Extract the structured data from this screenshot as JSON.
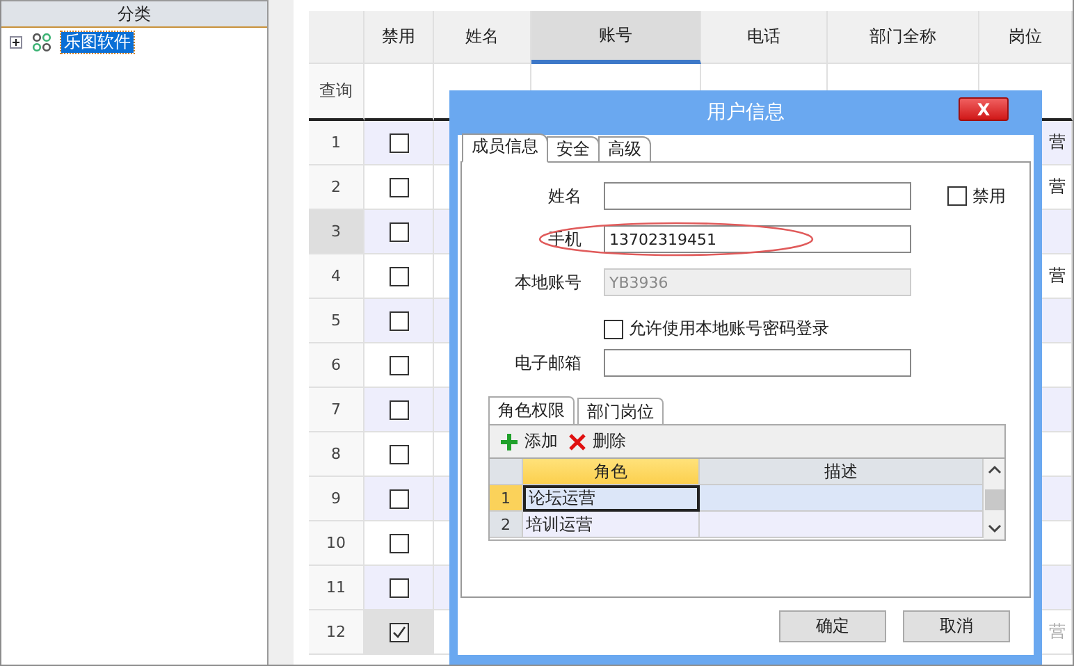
{
  "category_panel": {
    "title": "分类",
    "tree": [
      {
        "label": "乐图软件",
        "selected": true,
        "expanded": false
      }
    ]
  },
  "table": {
    "columns": [
      {
        "label": "禁用",
        "selected": false
      },
      {
        "label": "姓名",
        "selected": false
      },
      {
        "label": "账号",
        "selected": true
      },
      {
        "label": "电话",
        "selected": false
      },
      {
        "label": "部门全称",
        "selected": false
      },
      {
        "label": "岗位",
        "selected": false
      }
    ],
    "query_label": "查询",
    "rows": [
      {
        "index": "1",
        "disabled": false,
        "selected": false,
        "post": "营"
      },
      {
        "index": "2",
        "disabled": false,
        "selected": false,
        "post": "营"
      },
      {
        "index": "3",
        "disabled": false,
        "selected": true
      },
      {
        "index": "4",
        "disabled": false,
        "selected": false,
        "post": "营"
      },
      {
        "index": "5",
        "disabled": false,
        "selected": false
      },
      {
        "index": "6",
        "disabled": false,
        "selected": false
      },
      {
        "index": "7",
        "disabled": false,
        "selected": false
      },
      {
        "index": "8",
        "disabled": false,
        "selected": false
      },
      {
        "index": "9",
        "disabled": false,
        "selected": false
      },
      {
        "index": "10",
        "disabled": false,
        "selected": false
      },
      {
        "index": "11",
        "disabled": false,
        "selected": false
      },
      {
        "index": "12",
        "disabled": true,
        "selected": false,
        "post": "营"
      }
    ]
  },
  "dialog": {
    "title": "用户信息",
    "close": "X",
    "tabs": [
      {
        "label": "成员信息",
        "selected": true
      },
      {
        "label": "安全",
        "selected": false
      },
      {
        "label": "高级",
        "selected": false
      }
    ],
    "fields": [
      {
        "label": "姓名",
        "disabled": false,
        "highlighted": false
      },
      {
        "label": "手机",
        "value": "13702319451",
        "disabled": false,
        "highlighted": true
      },
      {
        "label": "本地账号",
        "value": "YB3936",
        "disabled": true,
        "highlighted": false
      }
    ],
    "ban_checkbox": {
      "label": "禁用",
      "checked": false
    },
    "allow_local_login": {
      "label": "允许使用本地账号密码登录",
      "checked": false
    },
    "email": {
      "label": "电子邮箱"
    },
    "sub_tabs": [
      {
        "label": "角色权限",
        "selected": true
      },
      {
        "label": "部门岗位",
        "selected": false
      }
    ],
    "toolbar": [
      {
        "label": "添加",
        "kind": "add"
      },
      {
        "label": "删除",
        "kind": "delete"
      }
    ],
    "grid": {
      "columns": [
        {
          "label": "角色",
          "selected": true
        },
        {
          "label": "描述",
          "selected": false
        }
      ],
      "rows": [
        {
          "index": "1",
          "role": "论坛运营",
          "selected": true
        },
        {
          "index": "2",
          "role": "培训运营",
          "selected": false
        }
      ]
    },
    "buttons": [
      "确定",
      "取消"
    ]
  }
}
